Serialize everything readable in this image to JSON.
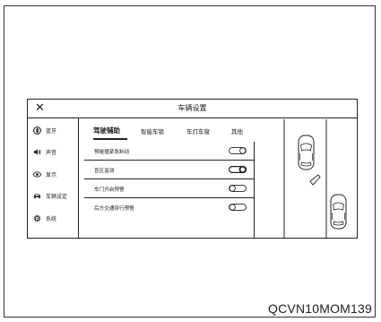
{
  "document_code": "QCVN10MOM139",
  "header": {
    "close_icon": "close-icon",
    "title": "车辆设置"
  },
  "sidebar": {
    "items": [
      {
        "icon": "bluetooth-icon",
        "label": "蓝牙"
      },
      {
        "icon": "speaker-icon",
        "label": "声音"
      },
      {
        "icon": "display-icon",
        "label": "显示"
      },
      {
        "icon": "car-icon",
        "label": "车辆设定"
      },
      {
        "icon": "gear-icon",
        "label": "系统"
      }
    ]
  },
  "tabs": [
    {
      "label": "驾驶辅助",
      "active": true
    },
    {
      "label": "智能车锁",
      "active": false
    },
    {
      "label": "车灯车窗",
      "active": false
    },
    {
      "label": "其他",
      "active": false
    }
  ],
  "settings": [
    {
      "label": "预碰撞紧急制动",
      "state": "off"
    },
    {
      "label": "盲区监测",
      "state": "on"
    },
    {
      "label": "车门开启预警",
      "state": "off"
    },
    {
      "label": "后方交通穿行预警",
      "state": "off"
    }
  ],
  "illustration": {
    "name": "blind-spot-diagram"
  }
}
